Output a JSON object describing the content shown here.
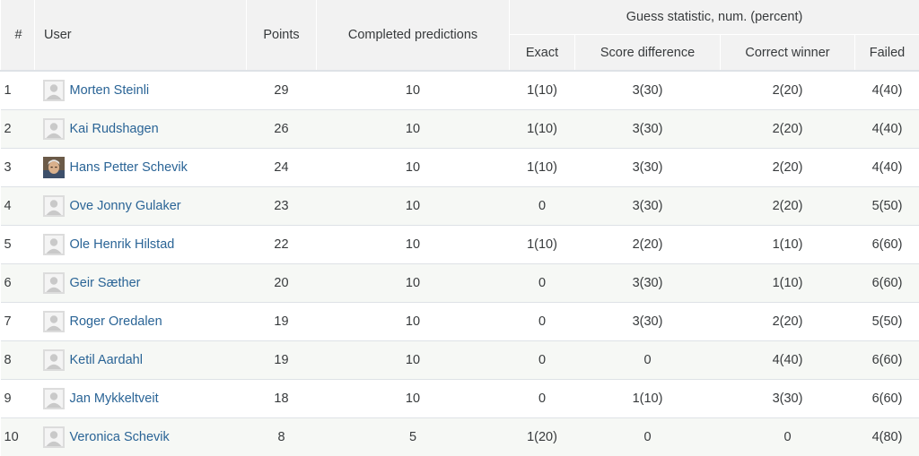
{
  "header": {
    "rank": "#",
    "user": "User",
    "points": "Points",
    "completed": "Completed predictions",
    "guess_group": "Guess statistic, num. (percent)",
    "exact": "Exact",
    "score_difference": "Score difference",
    "correct_winner": "Correct winner",
    "failed": "Failed"
  },
  "rows": [
    {
      "rank": "1",
      "name": "Morten Steinli",
      "avatar": "default-avatar",
      "points": "29",
      "completed": "10",
      "exact": "1(10)",
      "diff": "3(30)",
      "winner": "2(20)",
      "failed": "4(40)"
    },
    {
      "rank": "2",
      "name": "Kai Rudshagen",
      "avatar": "default-avatar",
      "points": "26",
      "completed": "10",
      "exact": "1(10)",
      "diff": "3(30)",
      "winner": "2(20)",
      "failed": "4(40)"
    },
    {
      "rank": "3",
      "name": "Hans Petter Schevik",
      "avatar": "photo-avatar",
      "points": "24",
      "completed": "10",
      "exact": "1(10)",
      "diff": "3(30)",
      "winner": "2(20)",
      "failed": "4(40)"
    },
    {
      "rank": "4",
      "name": "Ove Jonny Gulaker",
      "avatar": "default-avatar",
      "points": "23",
      "completed": "10",
      "exact": "0",
      "diff": "3(30)",
      "winner": "2(20)",
      "failed": "5(50)"
    },
    {
      "rank": "5",
      "name": "Ole Henrik Hilstad",
      "avatar": "default-avatar",
      "points": "22",
      "completed": "10",
      "exact": "1(10)",
      "diff": "2(20)",
      "winner": "1(10)",
      "failed": "6(60)"
    },
    {
      "rank": "6",
      "name": "Geir Sæther",
      "avatar": "default-avatar",
      "points": "20",
      "completed": "10",
      "exact": "0",
      "diff": "3(30)",
      "winner": "1(10)",
      "failed": "6(60)"
    },
    {
      "rank": "7",
      "name": "Roger Oredalen",
      "avatar": "default-avatar",
      "points": "19",
      "completed": "10",
      "exact": "0",
      "diff": "3(30)",
      "winner": "2(20)",
      "failed": "5(50)"
    },
    {
      "rank": "8",
      "name": "Ketil Aardahl",
      "avatar": "default-avatar",
      "points": "19",
      "completed": "10",
      "exact": "0",
      "diff": "0",
      "winner": "4(40)",
      "failed": "6(60)"
    },
    {
      "rank": "9",
      "name": "Jan Mykkeltveit",
      "avatar": "default-avatar",
      "points": "18",
      "completed": "10",
      "exact": "0",
      "diff": "1(10)",
      "winner": "3(30)",
      "failed": "6(60)"
    },
    {
      "rank": "10",
      "name": "Veronica Schevik",
      "avatar": "default-avatar",
      "points": "8",
      "completed": "5",
      "exact": "1(20)",
      "diff": "0",
      "winner": "0",
      "failed": "4(80)"
    }
  ],
  "colors": {
    "link": "#2a6496",
    "header_bg": "#f2f2f2",
    "stripe_bg": "#f6f8f5",
    "border": "#dee2e6"
  }
}
